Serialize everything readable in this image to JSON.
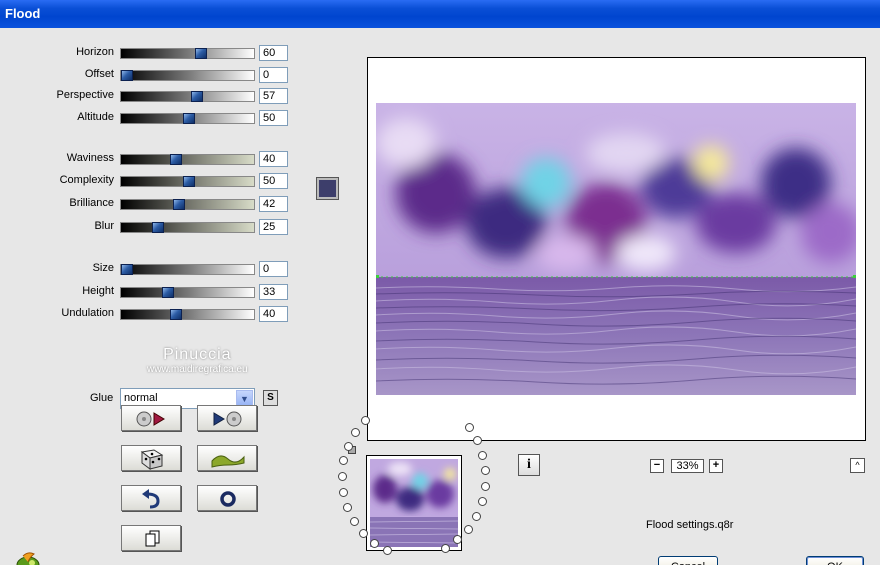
{
  "window": {
    "title": "Flood"
  },
  "sliders": [
    {
      "label": "Horizon",
      "value": "60",
      "fraction": 0.6,
      "track": "gray"
    },
    {
      "label": "Offset",
      "value": "0",
      "fraction": 0.0,
      "track": "gray"
    },
    {
      "label": "Perspective",
      "value": "57",
      "fraction": 0.57,
      "track": "gray"
    },
    {
      "label": "Altitude",
      "value": "50",
      "fraction": 0.5,
      "track": "gray"
    },
    {
      "label": "Waviness",
      "value": "40",
      "fraction": 0.4,
      "track": "beige"
    },
    {
      "label": "Complexity",
      "value": "50",
      "fraction": 0.5,
      "track": "beige"
    },
    {
      "label": "Brilliance",
      "value": "42",
      "fraction": 0.42,
      "track": "beige"
    },
    {
      "label": "Blur",
      "value": "25",
      "fraction": 0.25,
      "track": "beige"
    },
    {
      "label": "Size",
      "value": "0",
      "fraction": 0.0,
      "track": "gray"
    },
    {
      "label": "Height",
      "value": "33",
      "fraction": 0.33,
      "track": "gray"
    },
    {
      "label": "Undulation",
      "value": "40",
      "fraction": 0.4,
      "track": "gray"
    }
  ],
  "color_swatch": "#3d3e6b",
  "glue": {
    "label": "Glue",
    "value": "normal",
    "s_button": "S"
  },
  "tool_buttons": [
    {
      "name": "load-preset-button",
      "icon": "disc-arrow-icon"
    },
    {
      "name": "save-preset-button",
      "icon": "arrow-disc-icon"
    },
    {
      "name": "random-button",
      "icon": "dice-icon"
    },
    {
      "name": "wave-button",
      "icon": "wave-icon"
    },
    {
      "name": "undo-button",
      "icon": "undo-arrow-icon"
    },
    {
      "name": "reset-button",
      "icon": "ring-icon"
    },
    {
      "name": "copy-button",
      "icon": "copy-pages-icon"
    }
  ],
  "watermark": {
    "line1": "Pinuccia",
    "line2": "www.maidiregrafica.eu"
  },
  "zoom": {
    "minus": "−",
    "value": "33%",
    "plus": "+"
  },
  "info_label": "i",
  "collapse_label": "^",
  "settings_file": "Flood settings.q8r",
  "buttons": {
    "cancel": "Cancel",
    "ok": "OK"
  },
  "colors": {
    "title_bar": "#0a4fd6",
    "client_bg": "#e7e7e7"
  }
}
